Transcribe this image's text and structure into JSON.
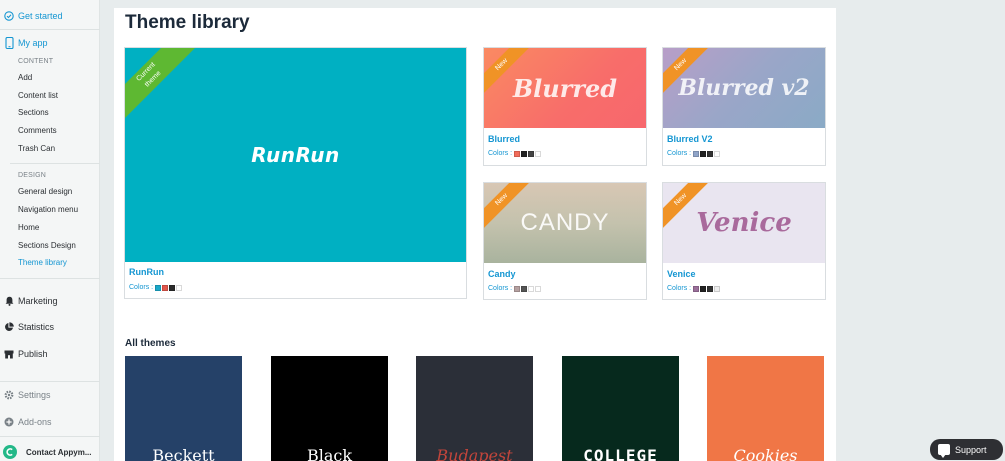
{
  "sidebar": {
    "get_started": "Get started",
    "my_app": "My app",
    "content_caption": "CONTENT",
    "content_items": [
      "Add",
      "Content list",
      "Sections",
      "Comments",
      "Trash Can"
    ],
    "design_caption": "DESIGN",
    "design_items": [
      "General design",
      "Navigation menu",
      "Home",
      "Sections Design",
      "Theme library"
    ],
    "marketing": "Marketing",
    "statistics": "Statistics",
    "publish": "Publish",
    "settings": "Settings",
    "addons": "Add-ons",
    "contact": "Contact Appym..."
  },
  "main": {
    "title": "Theme library",
    "current_ribbon": "Current theme",
    "new_ribbon": "New",
    "colors_label": "Colors :",
    "featured": {
      "name": "RunRun",
      "logo": "RunRun",
      "bg": "#00b0c2",
      "swatches": [
        "#1aa8c9",
        "#e2574c",
        "#2b2b2b",
        "#ffffff"
      ]
    },
    "cards": [
      {
        "name": "Blurred",
        "logo": "Blurred",
        "swatches": [
          "#f26d5b",
          "#222222",
          "#444444",
          "#ffffff"
        ]
      },
      {
        "name": "Blurred V2",
        "logo": "Blurred v2",
        "swatches": [
          "#8fa4c8",
          "#222222",
          "#333333",
          "#ffffff"
        ]
      },
      {
        "name": "Candy",
        "logo": "CANDY",
        "swatches": [
          "#b5a0a0",
          "#555555",
          "#ffffff",
          "#ffffff"
        ]
      },
      {
        "name": "Venice",
        "logo": "Venice",
        "swatches": [
          "#9a6f9a",
          "#222222",
          "#333333",
          "#eeeeee"
        ]
      }
    ],
    "all_themes_title": "All themes",
    "tiles": [
      {
        "label": "Beckett",
        "bg": "#254168",
        "color": "#ffffff"
      },
      {
        "label": "Black",
        "bg": "#000000",
        "color": "#ffffff"
      },
      {
        "label": "Budapest",
        "bg": "#2b2f38",
        "color": "#c2453b"
      },
      {
        "label": "COLLEGE",
        "bg": "#06291d",
        "color": "#ffffff"
      },
      {
        "label": "Cookies",
        "bg": "#f07646",
        "color": "#ffffff"
      }
    ]
  },
  "support": {
    "label": "Support"
  }
}
